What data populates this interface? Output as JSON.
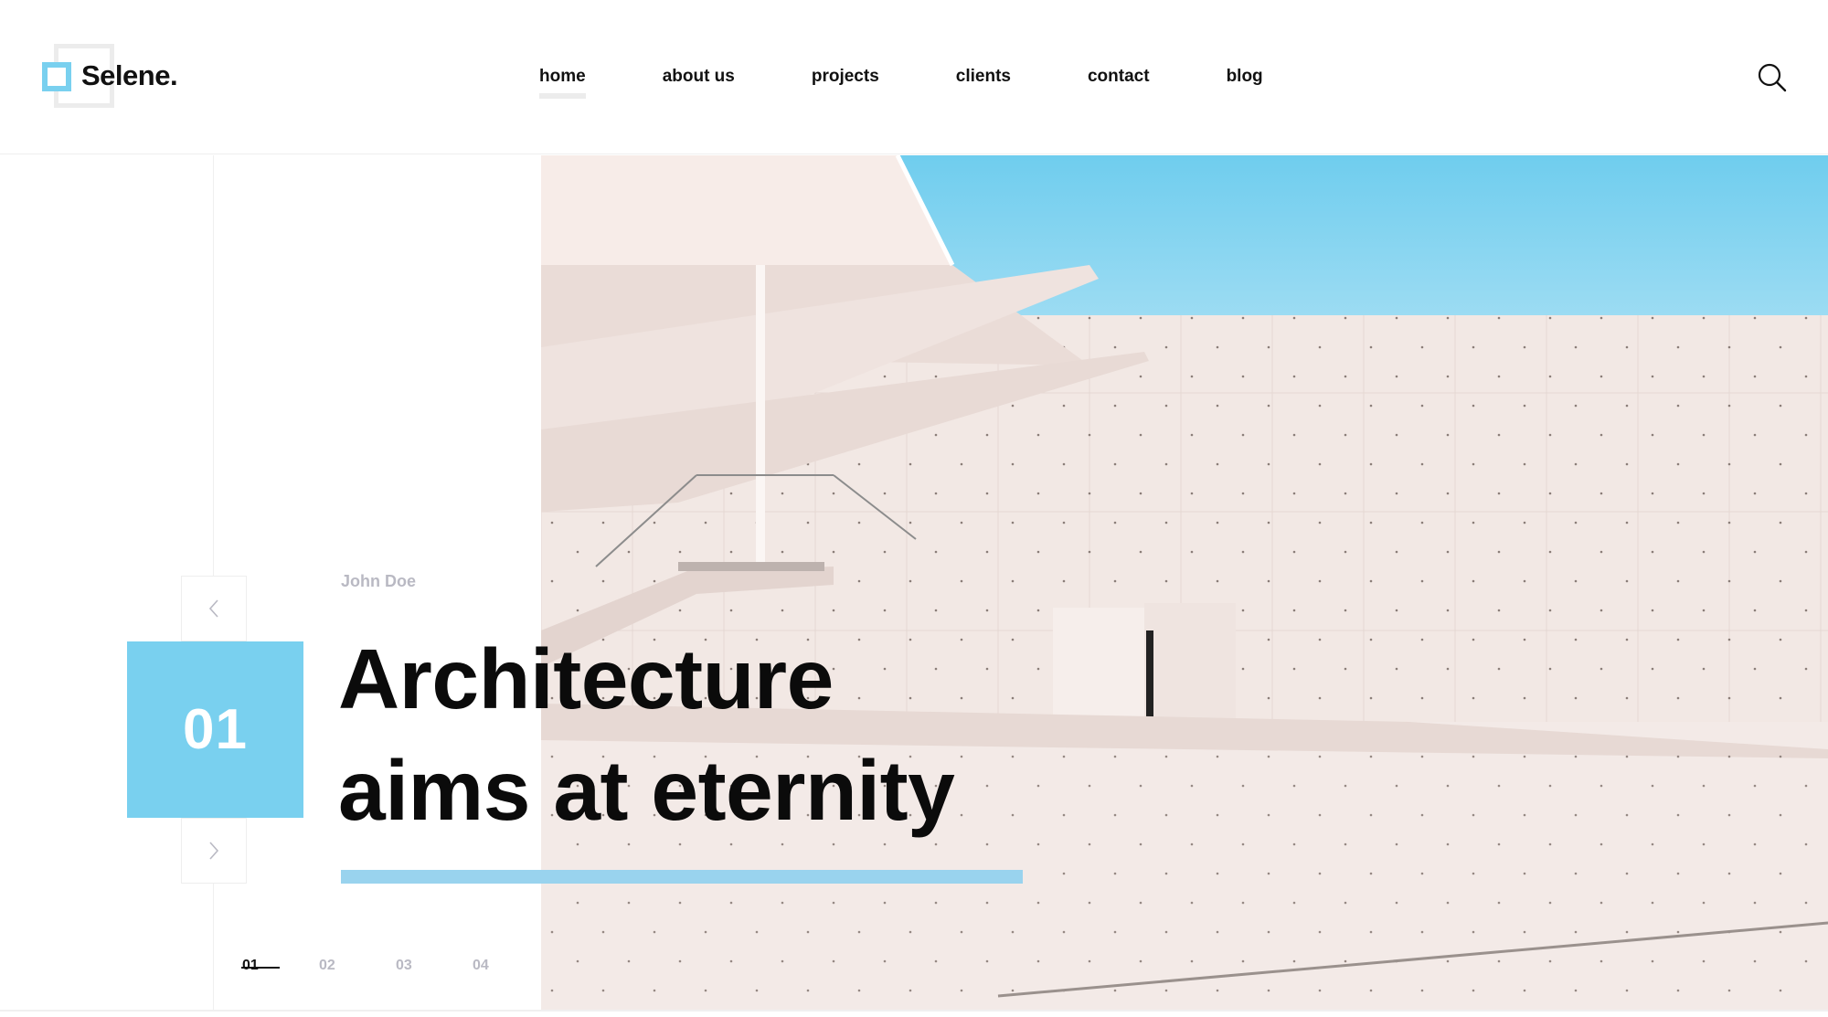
{
  "brand": {
    "name": "Selene."
  },
  "nav": {
    "items": [
      {
        "label": "home",
        "active": true
      },
      {
        "label": "about us",
        "active": false
      },
      {
        "label": "projects",
        "active": false
      },
      {
        "label": "clients",
        "active": false
      },
      {
        "label": "contact",
        "active": false
      },
      {
        "label": "blog",
        "active": false
      }
    ]
  },
  "icons": {
    "search": "search-icon",
    "prev": "chevron-left-icon",
    "next": "chevron-right-icon"
  },
  "slide": {
    "number": "01",
    "author": "John Doe",
    "title_lines": [
      "Architecture",
      "aims at eternity"
    ]
  },
  "pager": {
    "items": [
      "01",
      "02",
      "03",
      "04"
    ],
    "active_index": 0
  },
  "colors": {
    "accent": "#79d0ef",
    "title_bar": "#99d3ee",
    "text": "#0b0b0b",
    "muted": "#b9b9c3",
    "sky": "#7fd3f0"
  }
}
